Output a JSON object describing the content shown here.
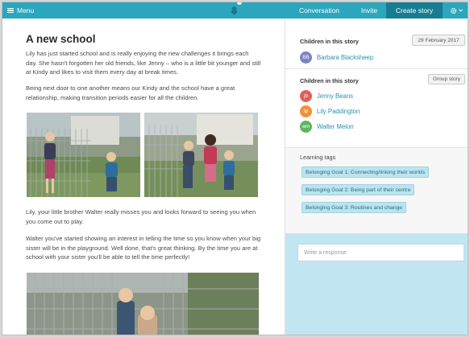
{
  "topbar": {
    "menu_label": "Menu",
    "tabs": [
      {
        "label": "Conversation"
      },
      {
        "label": "Invite"
      },
      {
        "label": "Create story"
      }
    ],
    "accent": "#2ba6bd",
    "active_color": "#167c92"
  },
  "story": {
    "title": "A new school",
    "paragraphs": [
      "Lily has just started school and is really enjoying the new challenges it brings each day. She hasn't forgotten her old friends, like Jenny – who is a little bit younger and still at Kindy and likes to visit them every day at break times.",
      "Being next door to one another means our Kindy and the school have a great relationship, making transition periods easier for all the children.",
      "Lily, your little brother Walter really misses you and looks forward to seeing you when you come out to play.",
      "Walter you've started showing an interest in telling the time so you know when your big sister will be in the playground. Well done, that's great thinking. By the time you are at school with your sister you'll be able to tell the time perfectly!"
    ]
  },
  "sidebar": {
    "children_heading": "Children in this story",
    "date": "29 February 2017",
    "story_children": [
      {
        "initials": "BB",
        "name": "Barbara Blacksheep",
        "color": "#7b82c4"
      }
    ],
    "group_heading": "Children in this story",
    "group_button": "Group story",
    "group_children": [
      {
        "initials": "jb",
        "name": "Jenny Beans",
        "color": "#e0605a"
      },
      {
        "initials": "lp",
        "name": "Lily Paddington",
        "color": "#f0913a"
      },
      {
        "initials": "wm",
        "name": "Walter Melon",
        "color": "#5db65d"
      }
    ],
    "tags_heading": "Learning tags",
    "tags": [
      "Belonging Goal 1: Connecting/linking their worlds",
      "Belonging Goal 2: Being part of their centre",
      "Belonging Goal 3: Routines and change"
    ],
    "response_placeholder": "Write a response"
  }
}
